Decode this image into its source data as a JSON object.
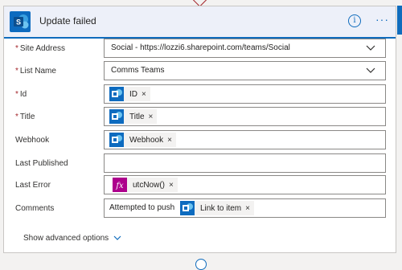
{
  "card": {
    "title": "Update failed",
    "icon": "sharepoint-icon",
    "accent": "#0f6cbd"
  },
  "fields": {
    "site_address": {
      "label": "Site Address",
      "required": "*",
      "value": "Social - https://lozzi6.sharepoint.com/teams/Social"
    },
    "list_name": {
      "label": "List Name",
      "required": "*",
      "value": "Comms Teams"
    },
    "id": {
      "label": "Id",
      "required": "*",
      "token": "ID"
    },
    "title": {
      "label": "Title",
      "required": "*",
      "token": "Title"
    },
    "webhook": {
      "label": "Webhook",
      "token": "Webhook"
    },
    "last_published": {
      "label": "Last Published",
      "value": ""
    },
    "last_error": {
      "label": "Last Error",
      "token": "utcNow()"
    },
    "comments": {
      "label": "Comments",
      "prefix_text": "Attempted to push",
      "token": "Link to item"
    }
  },
  "advanced": {
    "label": "Show advanced options"
  },
  "token_remove_glyph": "×"
}
